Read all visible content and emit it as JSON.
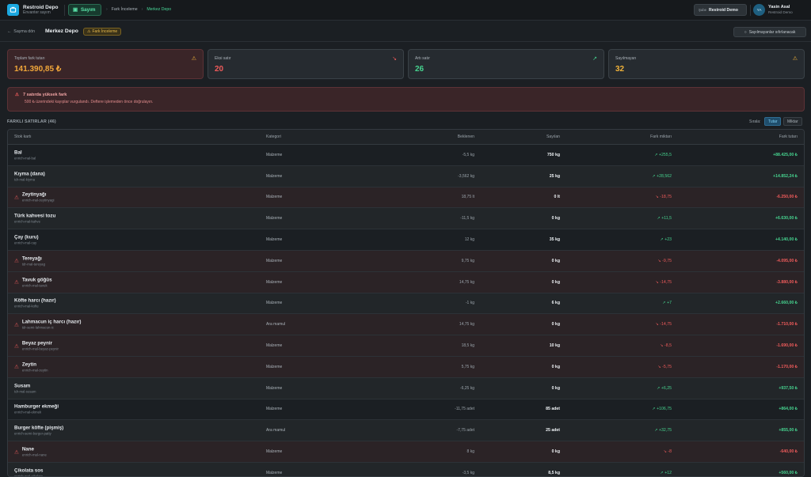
{
  "app": {
    "title": "Restroid Depo",
    "subtitle": "Envanter sayım"
  },
  "nav": {
    "active_label": "Sayım"
  },
  "breadcrumb": [
    "Fark İnceleme",
    "Merkez Depo"
  ],
  "header_right": {
    "demo_key": "Şube",
    "demo_label": "Restroid Demo",
    "user_initials": "YA",
    "user_name": "Yasin Asal",
    "user_role": "Restroid Demo"
  },
  "subbar": {
    "back_label": "Sayma dön",
    "title": "Merkez Depo",
    "badge": "Fark İnceleme",
    "reset_label": "Sayılmayanlar sıfırlanacak"
  },
  "cards": [
    {
      "label": "Toplam fark tutarı",
      "value": "141.390,85 ₺",
      "color": "#f0a63a",
      "icon": "alert-triangle-icon",
      "icon_glyph": "⚠"
    },
    {
      "label": "Eksi satır",
      "value": "20",
      "color": "#ef5b5b",
      "icon": "trend-down-icon",
      "icon_glyph": "↘"
    },
    {
      "label": "Artı satır",
      "value": "26",
      "color": "#46d38f",
      "icon": "trend-up-icon",
      "icon_glyph": "↗"
    },
    {
      "label": "Sayılmayan",
      "value": "32",
      "color": "#f0b23a",
      "icon": "alert-triangle-icon",
      "icon_glyph": "⚠"
    }
  ],
  "alert": {
    "title": "7 satırda yüksek fark",
    "desc": "500 ₺ üzerindeki kayıplar vurgulandı. Deftere işlemeden önce doğrulayın."
  },
  "section": {
    "title": "FARKLI SATIRLAR (46)",
    "sort_label": "Sırala:",
    "sort_amount": "Tutar",
    "sort_qty": "Miktar"
  },
  "table": {
    "headers": {
      "name": "Stok kartı",
      "category": "Kategori",
      "expected": "Beklenen",
      "counted": "Sayılan",
      "diff": "Fark miktarı",
      "amount": "Fark tutarı"
    },
    "rows": [
      {
        "name": "Bal",
        "sku": "enrich-mal-bal",
        "cat": "Malzeme",
        "exp": "-5,5 kg",
        "cnt": "750 kg",
        "diff": "+255,5",
        "amt": "+88.425,00 ₺",
        "up": true,
        "warn": false
      },
      {
        "name": "Kıyma (dana)",
        "sku": "tdr-mal-kiyma",
        "cat": "Malzeme",
        "exp": "-3,562 kg",
        "cnt": "25 kg",
        "diff": "+28,562",
        "amt": "+14.852,24 ₺",
        "up": true,
        "warn": false
      },
      {
        "name": "Zeytinyağı",
        "sku": "enrich-mal-zeytinyagi",
        "cat": "Malzeme",
        "exp": "18,75 lt",
        "cnt": "0 lt",
        "diff": "-18,75",
        "amt": "-6.250,00 ₺",
        "up": false,
        "warn": true
      },
      {
        "name": "Türk kahvesi tozu",
        "sku": "enrich-mal-kahve",
        "cat": "Malzeme",
        "exp": "-11,5 kg",
        "cnt": "0 kg",
        "diff": "+11,5",
        "amt": "+6.630,00 ₺",
        "up": true,
        "warn": false
      },
      {
        "name": "Çay (kuru)",
        "sku": "enrich-mal-cay",
        "cat": "Malzeme",
        "exp": "12 kg",
        "cnt": "35 kg",
        "diff": "+23",
        "amt": "+4.140,00 ₺",
        "up": true,
        "warn": false
      },
      {
        "name": "Tereyağı",
        "sku": "tdr-mal-tereyag",
        "cat": "Malzeme",
        "exp": "9,75 kg",
        "cnt": "0 kg",
        "diff": "-9,75",
        "amt": "-4.095,00 ₺",
        "up": false,
        "warn": true
      },
      {
        "name": "Tavuk göğüs",
        "sku": "enrich-mal-tavuk",
        "cat": "Malzeme",
        "exp": "14,75 kg",
        "cnt": "0 kg",
        "diff": "-14,75",
        "amt": "-3.880,00 ₺",
        "up": false,
        "warn": true
      },
      {
        "name": "Köfte harcı (hazır)",
        "sku": "enrich-mal-kofte",
        "cat": "Malzeme",
        "exp": "-1 kg",
        "cnt": "6 kg",
        "diff": "+7",
        "amt": "+2.660,00 ₺",
        "up": true,
        "warn": false
      },
      {
        "name": "Lahmacun iç harcı (hazır)",
        "sku": "tdr-semi-lahmacun-ic",
        "cat": "Ara mamul",
        "exp": "14,75 kg",
        "cnt": "0 kg",
        "diff": "-14,75",
        "amt": "-1.710,00 ₺",
        "up": false,
        "warn": true
      },
      {
        "name": "Beyaz peynir",
        "sku": "enrich-mal-beyaz-peynir",
        "cat": "Malzeme",
        "exp": "18,5 kg",
        "cnt": "10 kg",
        "diff": "-8,5",
        "amt": "-1.690,00 ₺",
        "up": false,
        "warn": true
      },
      {
        "name": "Zeytin",
        "sku": "enrich-mal-zeytin",
        "cat": "Malzeme",
        "exp": "5,75 kg",
        "cnt": "0 kg",
        "diff": "-5,75",
        "amt": "-1.170,00 ₺",
        "up": false,
        "warn": true
      },
      {
        "name": "Susam",
        "sku": "tdr-mal-susam",
        "cat": "Malzeme",
        "exp": "-6,25 kg",
        "cnt": "0 kg",
        "diff": "+6,25",
        "amt": "+937,50 ₺",
        "up": true,
        "warn": false
      },
      {
        "name": "Hamburger ekmeği",
        "sku": "enrich-mal-ekmek",
        "cat": "Malzeme",
        "exp": "-11,75 adet",
        "cnt": "85 adet",
        "diff": "+106,75",
        "amt": "+864,00 ₺",
        "up": true,
        "warn": false
      },
      {
        "name": "Burger köfte (pişmiş)",
        "sku": "enrich-semi-burger-patty",
        "cat": "Ara mamul",
        "exp": "-7,75 adet",
        "cnt": "25 adet",
        "diff": "+32,75",
        "amt": "+855,00 ₺",
        "up": true,
        "warn": false
      },
      {
        "name": "Nane",
        "sku": "enrich-mal-nane",
        "cat": "Malzeme",
        "exp": "8 kg",
        "cnt": "0 kg",
        "diff": "-8",
        "amt": "-640,00 ₺",
        "up": false,
        "warn": true
      },
      {
        "name": "Çikolata sos",
        "sku": "enrich-mal-cikolata",
        "cat": "Malzeme",
        "exp": "-3,5 kg",
        "cnt": "8,5 kg",
        "diff": "+12",
        "amt": "+560,00 ₺",
        "up": true,
        "warn": false
      }
    ]
  }
}
